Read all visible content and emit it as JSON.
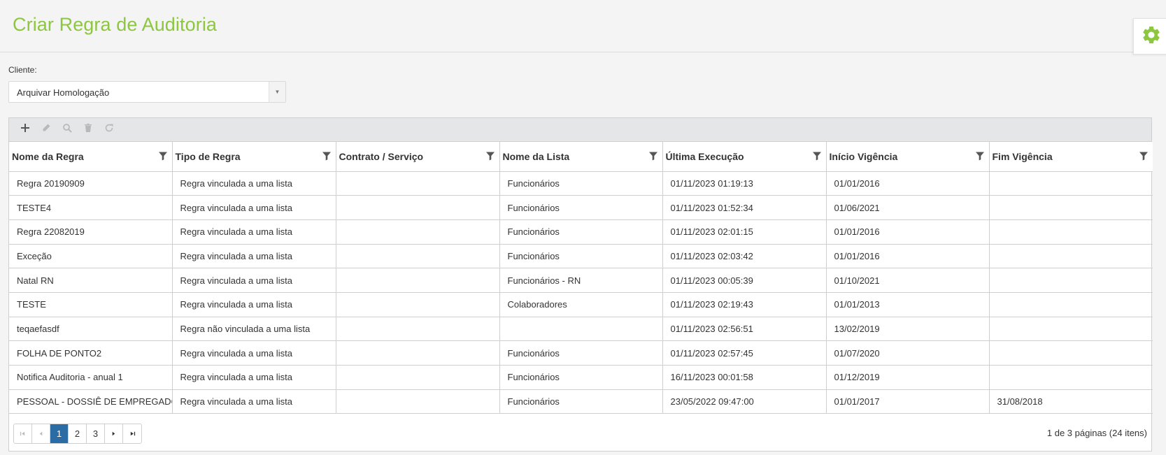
{
  "page": {
    "title": "Criar Regra de Auditoria"
  },
  "settings": {
    "icon": "gear-icon",
    "color": "#8dc63f"
  },
  "client": {
    "label": "Cliente:",
    "selected": "Arquivar Homologação"
  },
  "toolbar": {
    "buttons": [
      "plus-icon",
      "pencil-icon",
      "magnifier-icon",
      "trash-icon",
      "refresh-icon"
    ]
  },
  "table": {
    "columns": [
      "Nome da Regra",
      "Tipo de Regra",
      "Contrato / Serviço",
      "Nome da Lista",
      "Última Execução",
      "Início Vigência",
      "Fim Vigência"
    ],
    "rows": [
      [
        "Regra 20190909",
        "Regra vinculada a uma lista",
        "",
        "Funcionários",
        "01/11/2023 01:19:13",
        "01/01/2016",
        ""
      ],
      [
        "TESTE4",
        "Regra vinculada a uma lista",
        "",
        "Funcionários",
        "01/11/2023 01:52:34",
        "01/06/2021",
        ""
      ],
      [
        "Regra 22082019",
        "Regra vinculada a uma lista",
        "",
        "Funcionários",
        "01/11/2023 02:01:15",
        "01/01/2016",
        ""
      ],
      [
        "Exceção",
        "Regra vinculada a uma lista",
        "",
        "Funcionários",
        "01/11/2023 02:03:42",
        "01/01/2016",
        ""
      ],
      [
        "Natal RN",
        "Regra vinculada a uma lista",
        "",
        "Funcionários - RN",
        "01/11/2023 00:05:39",
        "01/10/2021",
        ""
      ],
      [
        "TESTE",
        "Regra vinculada a uma lista",
        "",
        "Colaboradores",
        "01/11/2023 02:19:43",
        "01/01/2013",
        ""
      ],
      [
        "teqaefasdf",
        "Regra não vinculada a uma lista",
        "",
        "",
        "01/11/2023 02:56:51",
        "13/02/2019",
        ""
      ],
      [
        "FOLHA DE PONTO2",
        "Regra vinculada a uma lista",
        "",
        "Funcionários",
        "01/11/2023 02:57:45",
        "01/07/2020",
        ""
      ],
      [
        "Notifica Auditoria - anual 1",
        "Regra vinculada a uma lista",
        "",
        "Funcionários",
        "16/11/2023 00:01:58",
        "01/12/2019",
        ""
      ],
      [
        "PESSOAL - DOSSIÊ DE EMPREGADO",
        "Regra vinculada a uma lista",
        "",
        "Funcionários",
        "23/05/2022 09:47:00",
        "01/01/2017",
        "31/08/2018"
      ]
    ]
  },
  "pager": {
    "pages": [
      "1",
      "2",
      "3"
    ],
    "current": "1",
    "info": "1 de 3 páginas (24 itens)",
    "active_color": "#2c6ca4"
  }
}
